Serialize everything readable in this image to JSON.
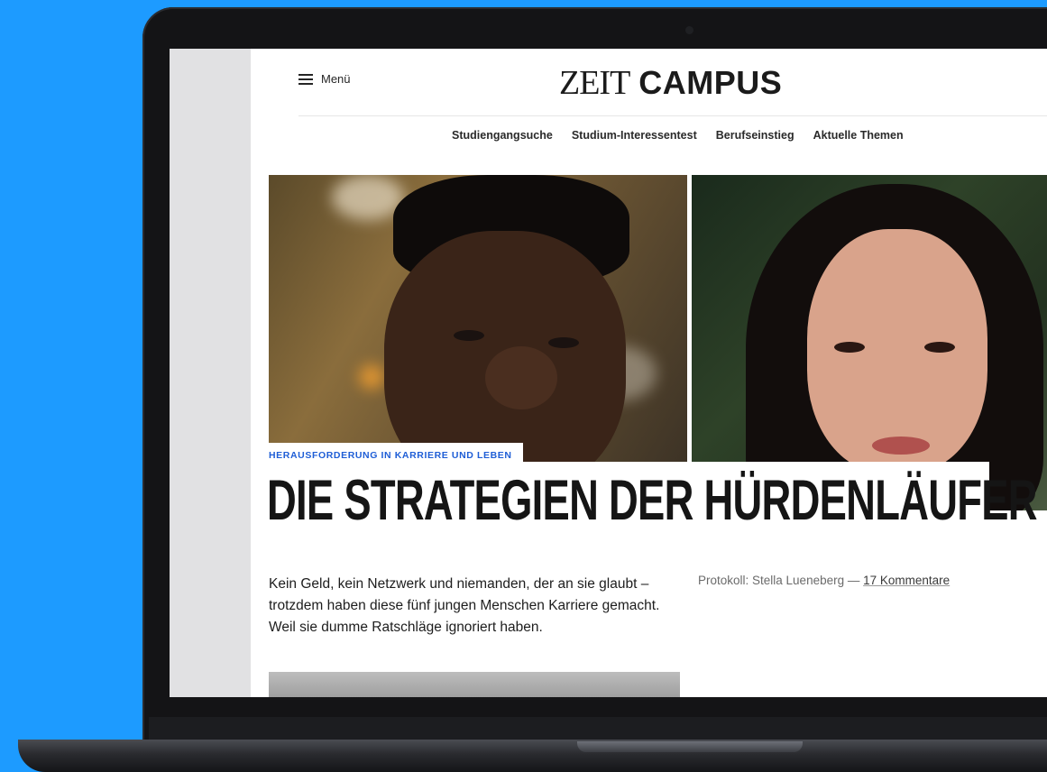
{
  "header": {
    "menu_label": "Menü",
    "logo_zeit": "ZEIT",
    "logo_campus": "CAMPUS"
  },
  "nav": [
    {
      "label": "Studiengangsuche"
    },
    {
      "label": "Studium-Interessentest"
    },
    {
      "label": "Berufseinstieg"
    },
    {
      "label": "Aktuelle Themen"
    }
  ],
  "article": {
    "kicker": "HERAUSFORDERUNG IN KARRIERE UND LEBEN",
    "headline": "DIE STRATEGIEN DER HÜRDENLÄUFER",
    "teaser": "Kein Geld, kein Netzwerk und niemanden, der an sie glaubt – trotzdem haben diese fünf jungen Menschen Karriere gemacht. Weil sie dumme Ratschläge ignoriert haben.",
    "byline_author": "Protokoll: Stella Lueneberg",
    "byline_separator": " — ",
    "comments_link": "17 Kommentare"
  },
  "colors": {
    "background": "#1d9bff",
    "kicker": "#1f5ed6",
    "text": "#151515"
  }
}
